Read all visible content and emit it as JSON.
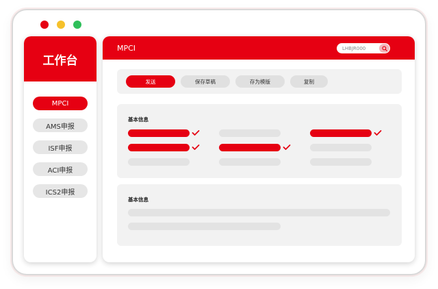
{
  "window": {
    "traffic_lights": {
      "red": "#e60012",
      "yellow": "#f6c12b",
      "green": "#2fbf5a"
    }
  },
  "sidebar": {
    "title": "工作台",
    "items": [
      {
        "label": "MPCI",
        "active": true
      },
      {
        "label": "AMS申报",
        "active": false
      },
      {
        "label": "ISF申报",
        "active": false
      },
      {
        "label": "ACI申报",
        "active": false
      },
      {
        "label": "ICS2申报",
        "active": false
      }
    ]
  },
  "main": {
    "title": "MPCI",
    "search": {
      "value": "LHBJR000",
      "icon": "search-icon"
    },
    "toolbar": {
      "send_label": "发送",
      "save_draft_label": "保存草稿",
      "save_template_label": "存为模版",
      "copy_label": "复制"
    },
    "section1": {
      "title": "基本信息"
    },
    "section2": {
      "title": "基本信息"
    }
  },
  "colors": {
    "accent": "#e60012",
    "placeholder": "#e3e3e3",
    "panel": "#f2f2f2"
  }
}
